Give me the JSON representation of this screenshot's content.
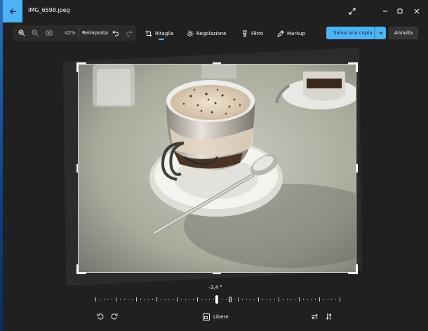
{
  "window": {
    "title": "IMG_6598.jpeg",
    "back_icon": "back-arrow-icon",
    "controls": [
      "expand-icon",
      "minimize-icon",
      "maximize-icon",
      "close-icon"
    ]
  },
  "toolbar": {
    "zoom_level": "42%",
    "reset_label": "Reimposta",
    "undo_icon": "undo-icon",
    "redo_icon": "redo-icon",
    "tabs": [
      {
        "label": "Ritaglia",
        "icon": "crop-icon",
        "active": true
      },
      {
        "label": "Regolazione",
        "icon": "brightness-icon",
        "active": false
      },
      {
        "label": "Filtro",
        "icon": "filter-icon",
        "active": false
      },
      {
        "label": "Markup",
        "icon": "pen-icon",
        "active": false
      }
    ],
    "save_label": "Salva una copia",
    "cancel_label": "Annulla"
  },
  "rotation": {
    "angle_label": "-3,4 °",
    "angle_value": -3.4,
    "min": -45,
    "max": 45
  },
  "bottom": {
    "aspect_label": "Libere",
    "rotate_left_icon": "rotate-left-icon",
    "rotate_right_icon": "rotate-right-icon",
    "flip_horizontal_icon": "flip-horizontal-icon",
    "flip_vertical_icon": "flip-vertical-icon"
  },
  "colors": {
    "accent": "#4cb3f4",
    "background": "#202020",
    "toolbar_group": "#2b2b2b"
  }
}
